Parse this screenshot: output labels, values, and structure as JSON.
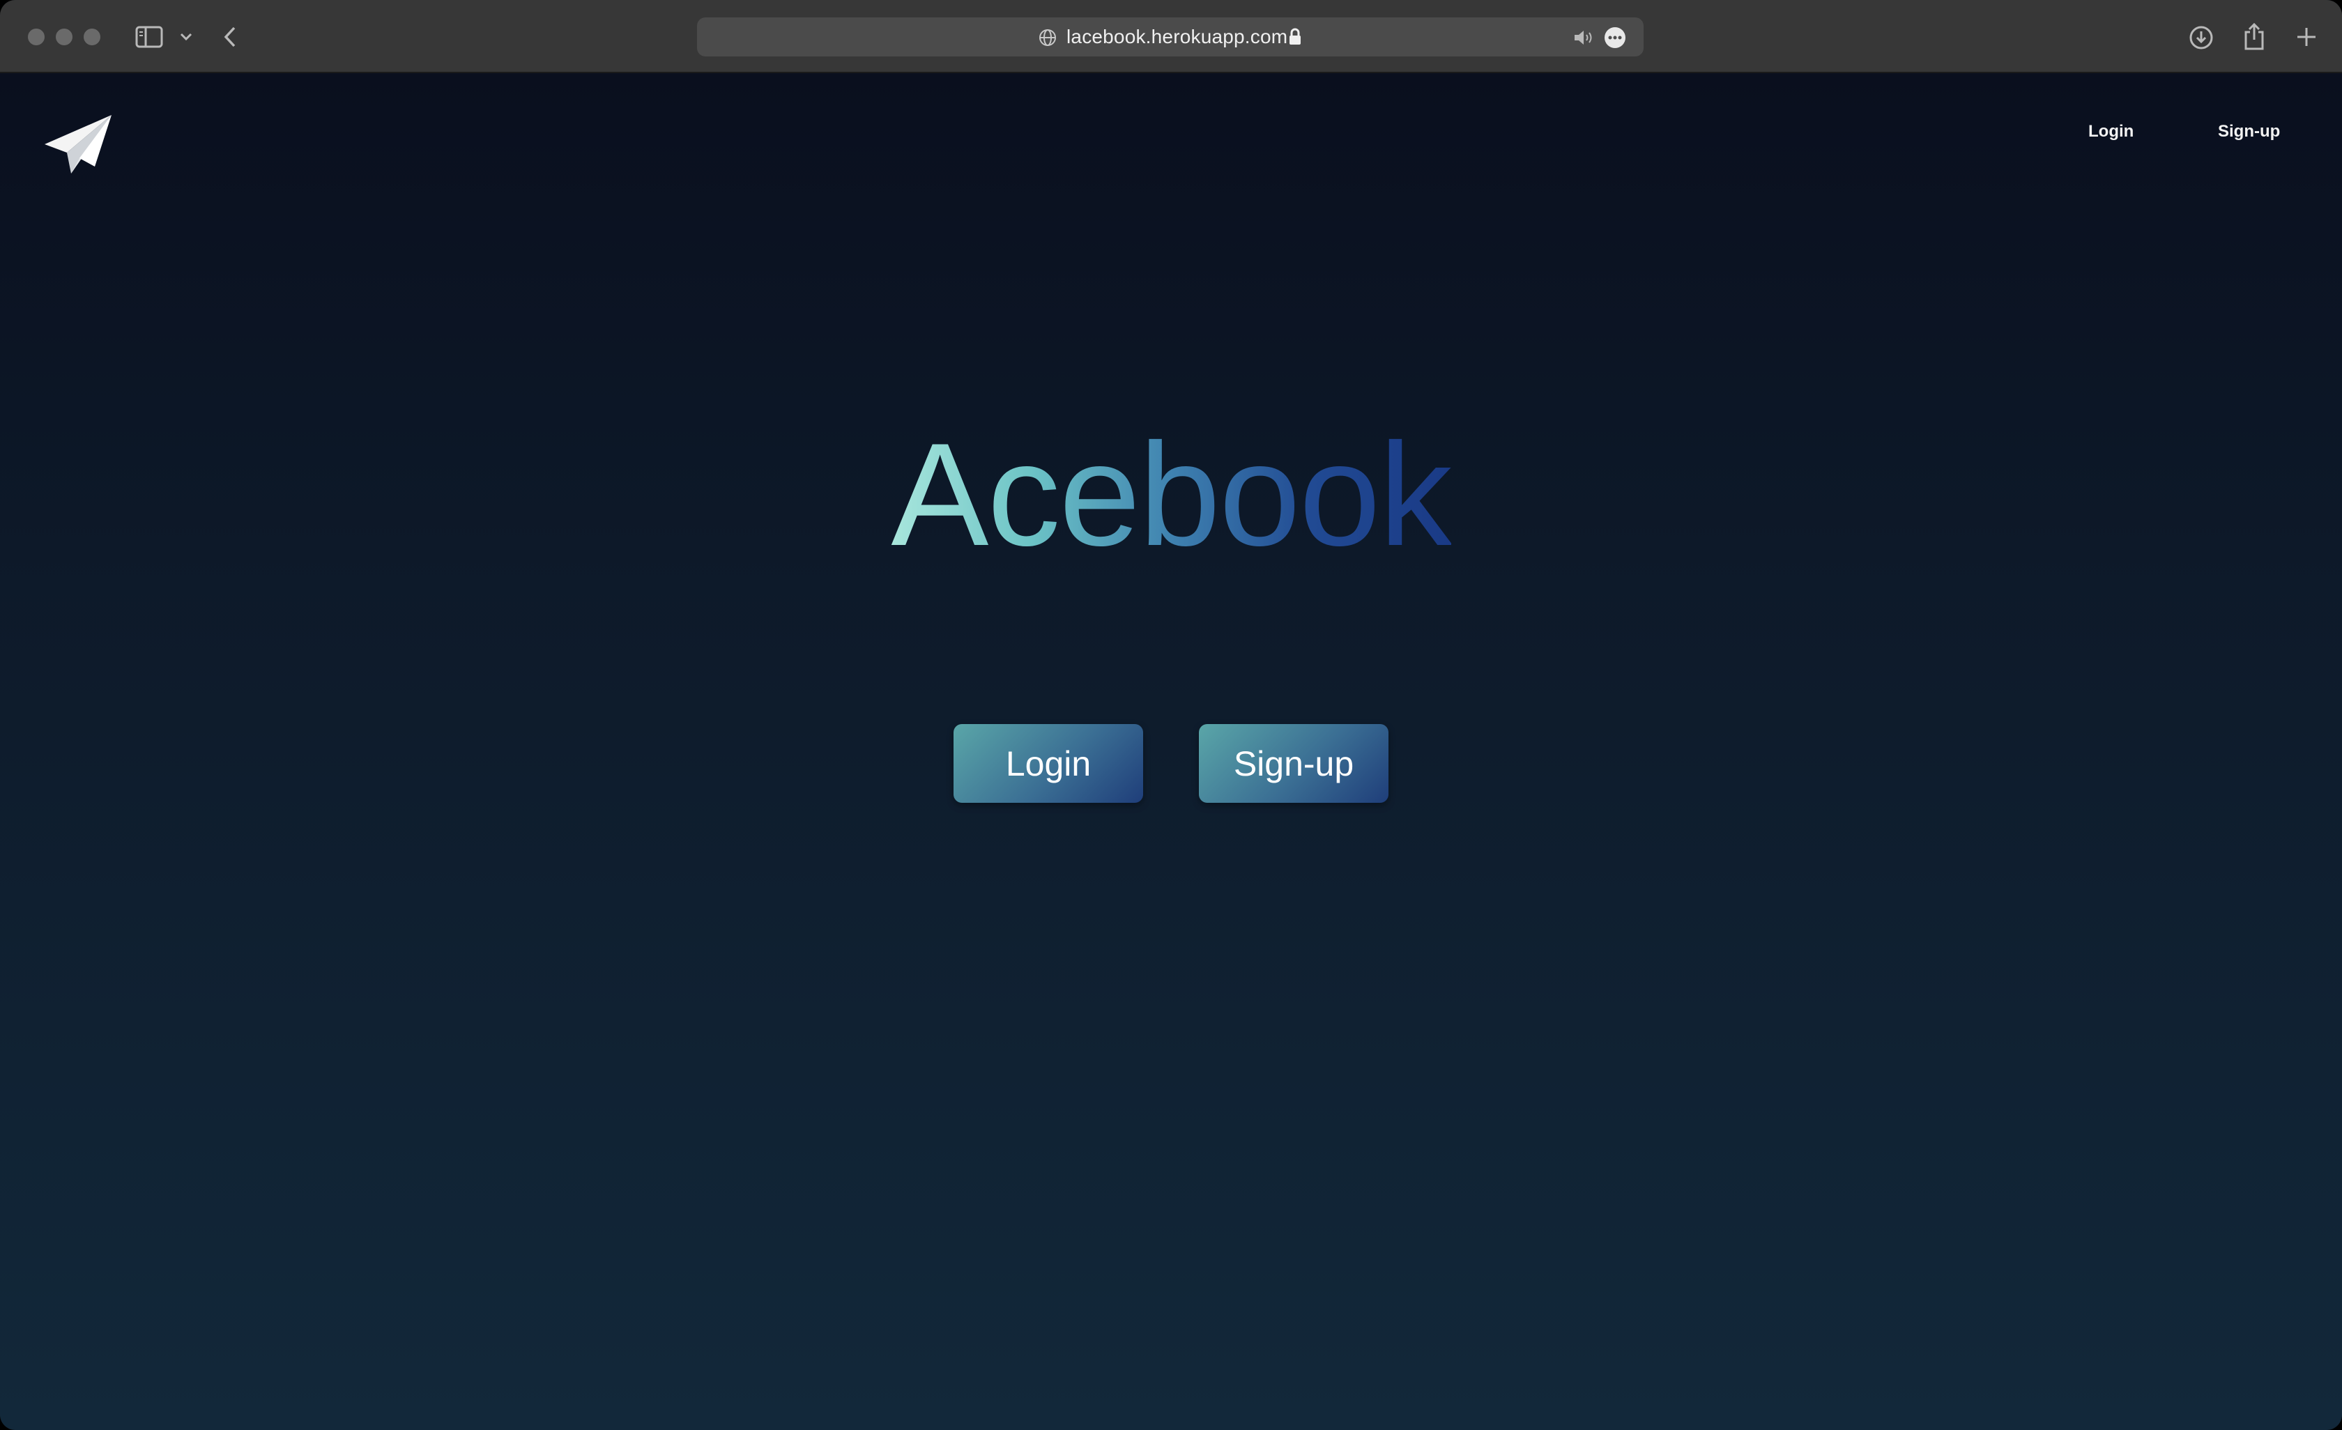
{
  "browser": {
    "url": "lacebook.herokuapp.com"
  },
  "nav": {
    "login_label": "Login",
    "signup_label": "Sign-up"
  },
  "hero": {
    "title": "Acebook",
    "login_button": "Login",
    "signup_button": "Sign-up"
  },
  "icons": {
    "logo": "paper-plane-icon",
    "sidebar": "sidebar-icon",
    "back": "chevron-left-icon",
    "site": "globe-icon",
    "lock": "lock-icon",
    "audio": "speaker-icon",
    "more": "more-icon",
    "download": "download-icon",
    "share": "share-icon",
    "new_tab": "plus-icon"
  },
  "colors": {
    "page_top": "#0a0f1e",
    "page_bottom": "#12283a",
    "brand_start": "#a8e6dc",
    "brand_end": "#1a3a86",
    "button_start": "#5aa6a8",
    "button_end": "#1f3e7a"
  }
}
